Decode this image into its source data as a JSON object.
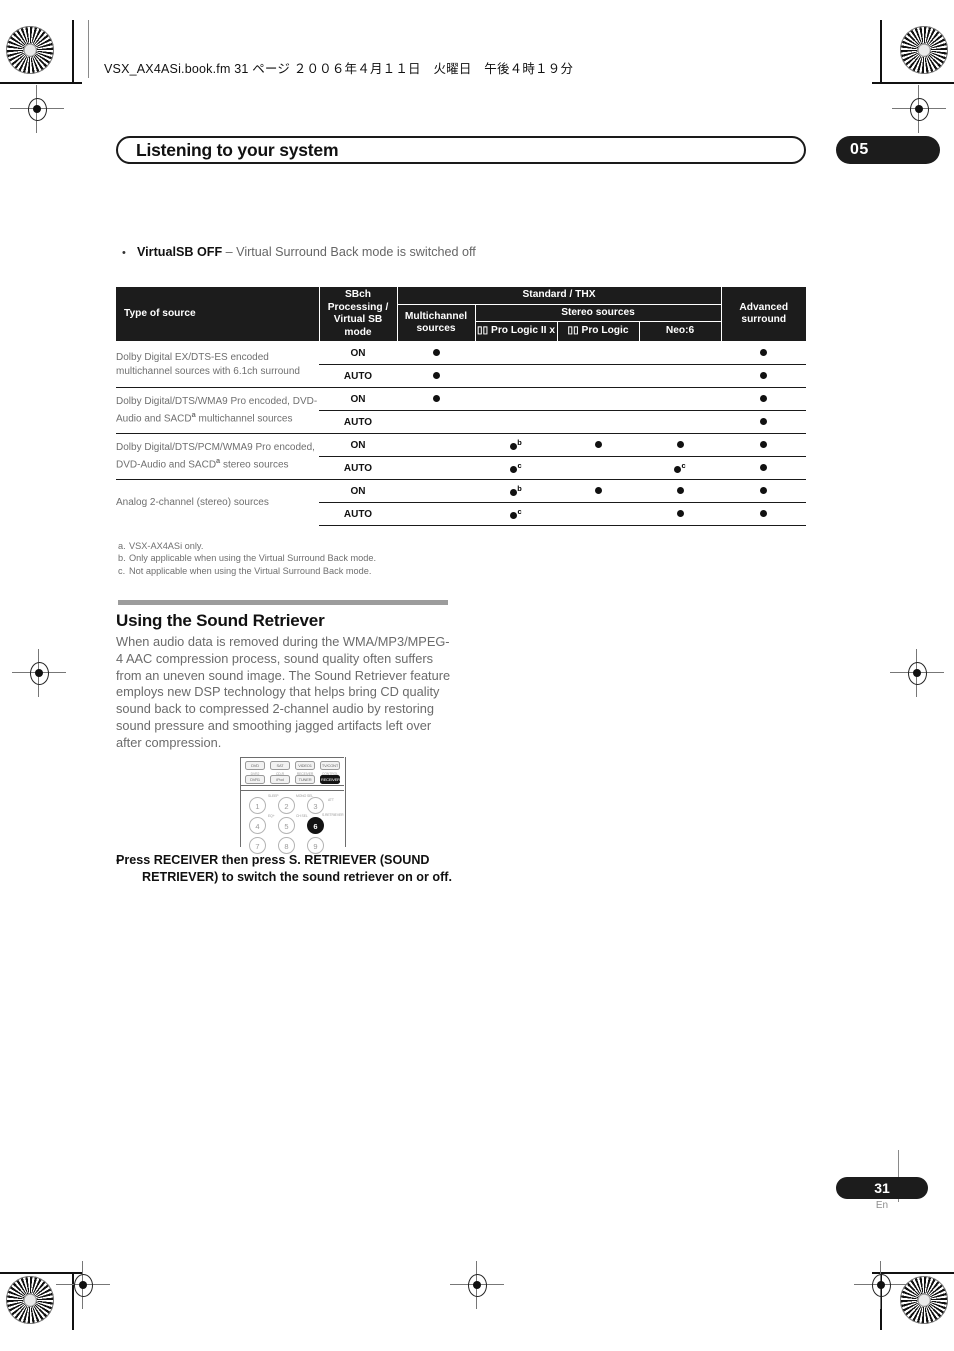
{
  "header": {
    "fm_line": "VSX_AX4ASi.book.fm  31 ページ  ２００６年４月１１日　火曜日　午後４時１９分",
    "chapter_title": "Listening to your system",
    "chapter_number": "05"
  },
  "virtualsb_bullet": {
    "bold": "VirtualSB OFF",
    "rest": " – Virtual Surround Back mode is switched off"
  },
  "table": {
    "headers": {
      "type_of_source": "Type of source",
      "sbch_mode": "SBch Processing / Virtual SB mode",
      "standard_thx": "Standard / THX",
      "multichannel_sources": "Multichannel sources",
      "stereo_sources": "Stereo sources",
      "pro_logic_iix": "Pro Logic II x",
      "pro_logic": "Pro Logic",
      "neo6": "Neo:6",
      "advanced_surround": "Advanced surround"
    },
    "dolby_symbol": "▯▯",
    "groups": [
      {
        "source": "Dolby Digital EX/DTS-ES encoded multichannel sources with 6.1ch surround",
        "source_sup": "",
        "rows": [
          {
            "mode": "ON",
            "multichannel": "dot",
            "plii": "",
            "pl": "",
            "neo6": "",
            "advanced": "dot"
          },
          {
            "mode": "AUTO",
            "multichannel": "dot",
            "plii": "",
            "pl": "",
            "neo6": "",
            "advanced": "dot"
          }
        ]
      },
      {
        "source": "Dolby Digital/DTS/WMA9 Pro encoded, DVD-Audio and SACD",
        "source_sup": "a",
        "source_tail": " multichannel sources",
        "rows": [
          {
            "mode": "ON",
            "multichannel": "dot",
            "plii": "",
            "pl": "",
            "neo6": "",
            "advanced": "dot"
          },
          {
            "mode": "AUTO",
            "multichannel": "",
            "plii": "",
            "pl": "",
            "neo6": "",
            "advanced": "dot"
          }
        ]
      },
      {
        "source": "Dolby Digital/DTS/PCM/WMA9 Pro encoded, DVD-Audio and SACD",
        "source_sup": "a",
        "source_tail": " stereo sources",
        "rows": [
          {
            "mode": "ON",
            "multichannel": "",
            "plii": "dot",
            "plii_sup": "b",
            "pl": "dot",
            "neo6": "dot",
            "advanced": "dot"
          },
          {
            "mode": "AUTO",
            "multichannel": "",
            "plii": "dot",
            "plii_sup": "c",
            "pl": "",
            "neo6": "dot",
            "neo6_sup": "c",
            "advanced": "dot"
          }
        ]
      },
      {
        "source": "Analog 2-channel (stereo) sources",
        "source_sup": "",
        "rows": [
          {
            "mode": "ON",
            "multichannel": "",
            "plii": "dot",
            "plii_sup": "b",
            "pl": "dot",
            "neo6": "dot",
            "advanced": "dot"
          },
          {
            "mode": "AUTO",
            "multichannel": "",
            "plii": "dot",
            "plii_sup": "c",
            "pl": "",
            "neo6": "dot",
            "advanced": "dot"
          }
        ]
      }
    ]
  },
  "footnotes": [
    {
      "key": "a.",
      "text": "VSX-AX4ASi only."
    },
    {
      "key": "b.",
      "text": "Only applicable when using the Virtual Surround Back mode."
    },
    {
      "key": "c.",
      "text": "Not applicable when using the Virtual Surround Back mode."
    }
  ],
  "section": {
    "heading": "Using the Sound Retriever",
    "body": "When audio data is removed during the WMA/MP3/MPEG-4 AAC compression process, sound quality often suffers from an uneven sound image. The Sound Retriever feature employs new DSP technology that helps bring CD quality sound back to compressed 2-channel audio by restoring sound pressure and smoothing jagged artifacts left over after compression."
  },
  "remote": {
    "source_buttons_row1": [
      "DVD",
      "SAT",
      "VIDEO1",
      "TV/CONT"
    ],
    "source_buttons_row2": [
      "DVR1",
      "iPod",
      "TUNER",
      "RECEIVER"
    ],
    "source_labels_row2": [
      "DVR2",
      "CD-R",
      "RECEIVER",
      "CONTROL"
    ],
    "number_buttons": [
      "1",
      "2",
      "3",
      "4",
      "5",
      "6",
      "7",
      "8",
      "9"
    ],
    "number_labels": [
      "SLEEP",
      "MONO SEL",
      "ATT",
      "EQ+",
      "CH SEL",
      "S.RETRIEVER"
    ],
    "highlighted_button": "6",
    "highlighted_source_button": "RECEIVER"
  },
  "instruction": {
    "bullet": "•",
    "text": "Press RECEIVER then press S. RETRIEVER (SOUND RETRIEVER) to switch the sound retriever on or off."
  },
  "footer": {
    "page_number": "31",
    "language": "En"
  },
  "colors": {
    "ink": "#1c1c1c",
    "body_gray": "#6b6b6b",
    "rule_gray": "#9c9c9c"
  }
}
